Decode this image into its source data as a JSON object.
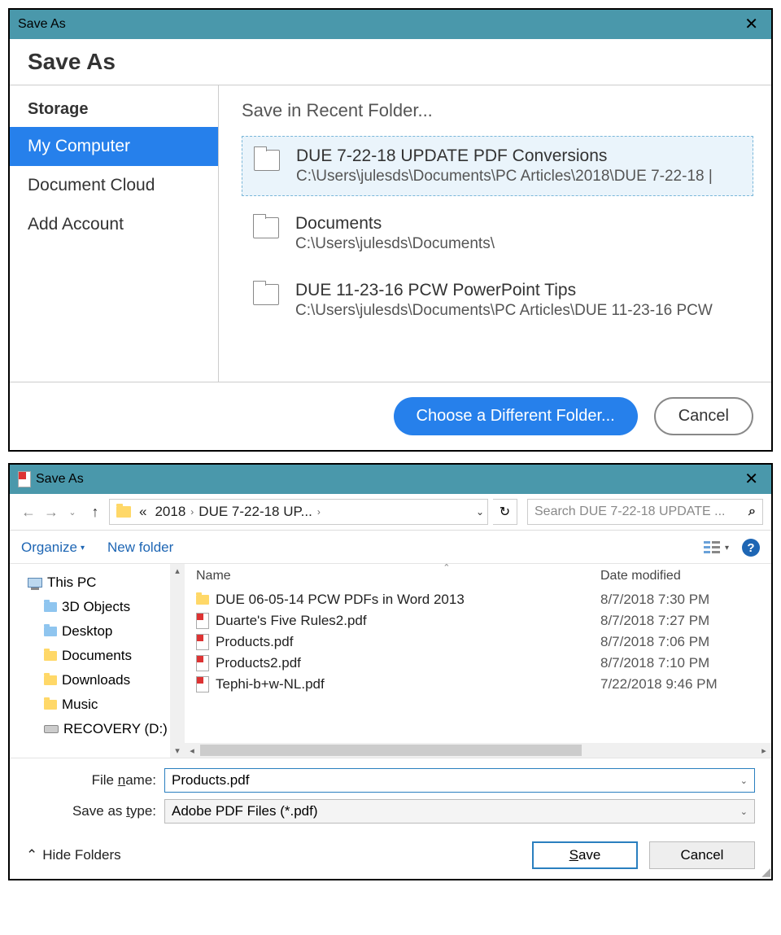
{
  "adobe": {
    "title": "Save As",
    "header": "Save As",
    "sidebar": {
      "storage_label": "Storage",
      "items": [
        {
          "label": "My Computer",
          "selected": true
        },
        {
          "label": "Document Cloud",
          "selected": false
        },
        {
          "label": "Add Account",
          "selected": false
        }
      ]
    },
    "main_title": "Save in Recent Folder...",
    "folders": [
      {
        "name": "DUE 7-22-18 UPDATE PDF Conversions",
        "path": "C:\\Users\\julesds\\Documents\\PC Articles\\2018\\DUE 7-22-18 |",
        "selected": true
      },
      {
        "name": "Documents",
        "path": "C:\\Users\\julesds\\Documents\\",
        "selected": false
      },
      {
        "name": "DUE 11-23-16 PCW PowerPoint Tips",
        "path": "C:\\Users\\julesds\\Documents\\PC Articles\\DUE 11-23-16 PCW",
        "selected": false
      }
    ],
    "footer": {
      "choose": "Choose a Different Folder...",
      "cancel": "Cancel"
    }
  },
  "explorer": {
    "title": "Save As",
    "breadcrumb": {
      "sep_left": "«",
      "items": [
        "2018",
        "DUE 7-22-18 UP..."
      ]
    },
    "search_placeholder": "Search DUE 7-22-18 UPDATE ...",
    "organize": "Organize",
    "new_folder": "New folder",
    "tree": [
      {
        "label": "This PC",
        "type": "thispc",
        "indent": false
      },
      {
        "label": "3D Objects",
        "type": "bluefolder",
        "indent": true
      },
      {
        "label": "Desktop",
        "type": "bluefolder",
        "indent": true
      },
      {
        "label": "Documents",
        "type": "folder",
        "indent": true
      },
      {
        "label": "Downloads",
        "type": "folder",
        "indent": true
      },
      {
        "label": "Music",
        "type": "folder",
        "indent": true
      },
      {
        "label": "RECOVERY (D:)",
        "type": "drive",
        "indent": true
      }
    ],
    "columns": {
      "name": "Name",
      "date": "Date modified"
    },
    "files": [
      {
        "name": "DUE 06-05-14 PCW PDFs in Word 2013",
        "type": "folder",
        "date": "8/7/2018 7:30 PM"
      },
      {
        "name": "Duarte's Five Rules2.pdf",
        "type": "pdf",
        "date": "8/7/2018 7:27 PM"
      },
      {
        "name": "Products.pdf",
        "type": "pdf",
        "date": "8/7/2018 7:06 PM"
      },
      {
        "name": "Products2.pdf",
        "type": "pdf",
        "date": "8/7/2018 7:10 PM"
      },
      {
        "name": "Tephi-b+w-NL.pdf",
        "type": "pdf",
        "date": "7/22/2018 9:46 PM"
      }
    ],
    "form": {
      "filename_label_pre": "File ",
      "filename_label_u": "n",
      "filename_label_post": "ame:",
      "filename_value": "Products.pdf",
      "type_label_pre": "Save as ",
      "type_label_u": "t",
      "type_label_post": "ype:",
      "type_value": "Adobe PDF Files (*.pdf)"
    },
    "footer": {
      "hide": "Hide Folders",
      "save_u": "S",
      "save_rest": "ave",
      "cancel": "Cancel"
    }
  }
}
